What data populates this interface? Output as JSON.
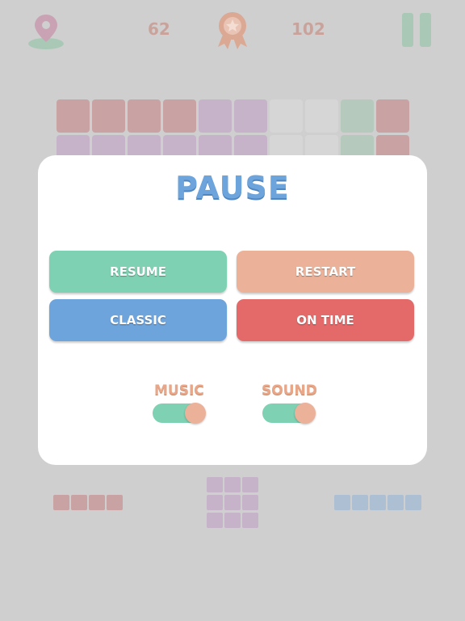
{
  "hud": {
    "best_score": "62",
    "current_score": "102",
    "location_icon": "map-pin-icon",
    "award_icon": "ribbon-star-icon",
    "pause_icon": "pause-icon"
  },
  "modal": {
    "title": "PAUSE",
    "buttons": {
      "resume": "RESUME",
      "restart": "RESTART",
      "classic": "CLASSIC",
      "on_time": "ON TIME"
    },
    "toggles": {
      "music_label": "MUSIC",
      "music_on": true,
      "sound_label": "SOUND",
      "sound_on": true
    }
  },
  "colors": {
    "resume": "#7ed1b3",
    "restart": "#ebb199",
    "classic": "#6ea4dc",
    "on_time": "#e46a6a",
    "toggle_track": "#7ed1b3",
    "toggle_knob": "#ebb199",
    "title": "#6ea4dc"
  }
}
